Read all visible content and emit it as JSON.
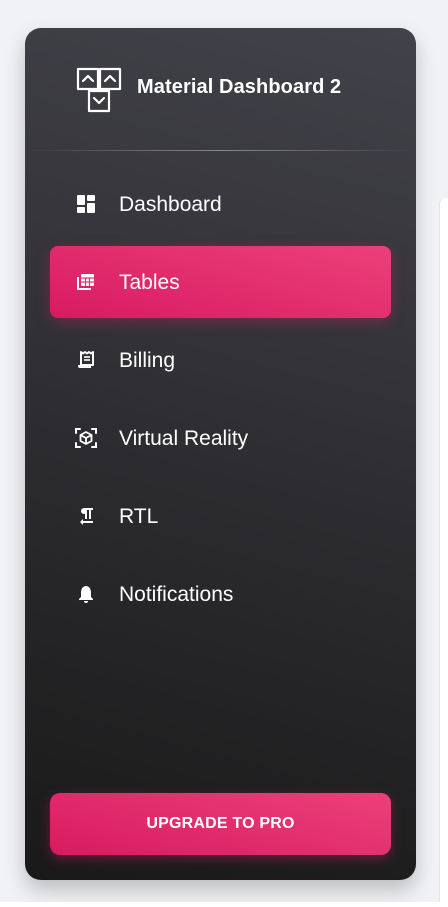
{
  "brand": {
    "name": "Material Dashboard 2",
    "logo_icon": "material-logo-icon"
  },
  "nav": {
    "items": [
      {
        "label": "Dashboard",
        "icon": "dashboard-icon",
        "active": false
      },
      {
        "label": "Tables",
        "icon": "table-view-icon",
        "active": true
      },
      {
        "label": "Billing",
        "icon": "receipt-icon",
        "active": false
      },
      {
        "label": "Virtual Reality",
        "icon": "view-in-ar-icon",
        "active": false
      },
      {
        "label": "RTL",
        "icon": "format-textdirection-r-to-l-icon",
        "active": false
      },
      {
        "label": "Notifications",
        "icon": "notifications-icon",
        "active": false
      }
    ]
  },
  "upgrade_label": "Upgrade to Pro",
  "colors": {
    "accent": "#e91e63",
    "sidebar_dark": "#191919",
    "sidebar_light": "#42424a",
    "background": "#f0f2f5"
  }
}
